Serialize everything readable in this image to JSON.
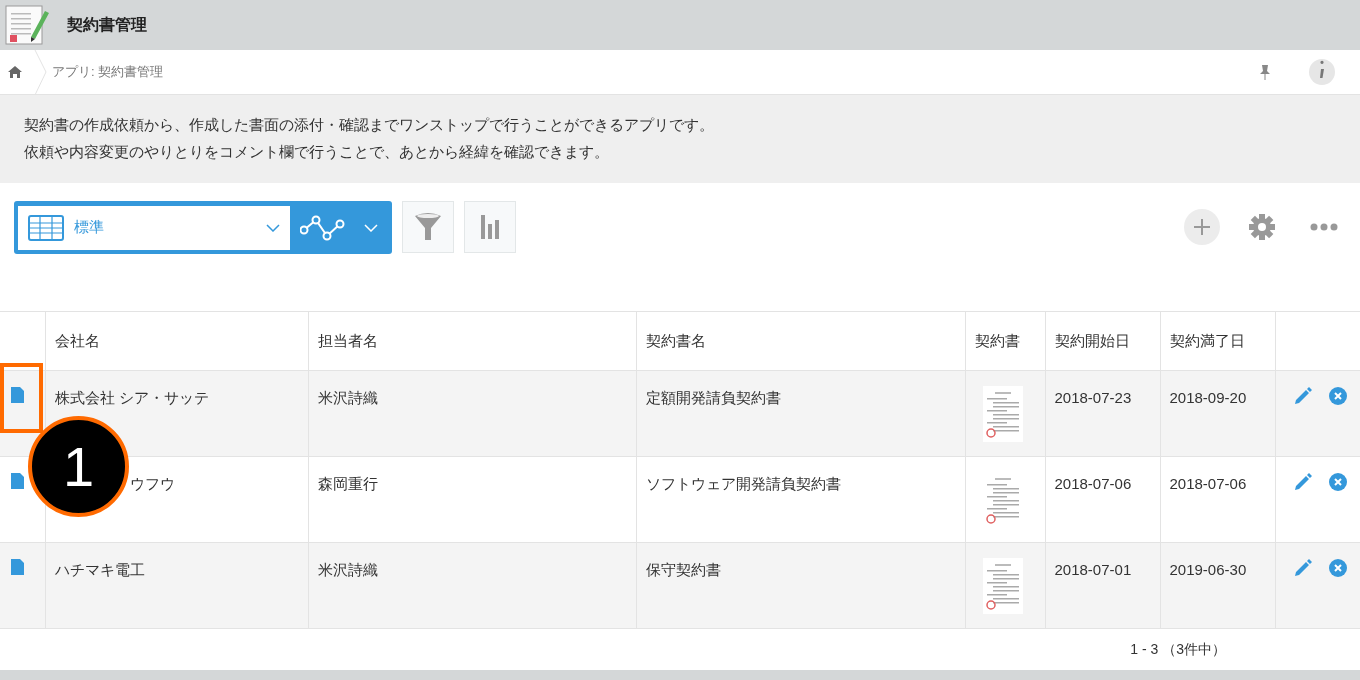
{
  "app": {
    "title": "契約書管理"
  },
  "breadcrumb": {
    "path": "アプリ: 契約書管理"
  },
  "description": [
    "契約書の作成依頼から、作成した書面の添付・確認までワンストップで行うことができるアプリです。",
    "依頼や内容変更のやりとりをコメント欄で行うことで、あとから経緯を確認できます。"
  ],
  "view_selector": {
    "value": "標準"
  },
  "table": {
    "columns": [
      "会社名",
      "担当者名",
      "契約書名",
      "契約書",
      "契約開始日",
      "契約満了日"
    ],
    "rows": [
      {
        "company": "株式会社 シア・サッテ",
        "person": "米沢詩織",
        "contract": "定額開発請負契約書",
        "start": "2018-07-23",
        "end": "2018-09-20",
        "covered": false,
        "highlighted": true
      },
      {
        "company": "ウフウ",
        "person": "森岡重行",
        "contract": "ソフトウェア開発請負契約書",
        "start": "2018-07-06",
        "end": "2018-07-06",
        "covered": true,
        "highlighted": false
      },
      {
        "company": "ハチマキ電工",
        "person": "米沢詩織",
        "contract": "保守契約書",
        "start": "2018-07-01",
        "end": "2019-06-30",
        "covered": false,
        "highlighted": false
      }
    ]
  },
  "pagination": "1 - 3 （3件中）",
  "callout": {
    "number": "1"
  }
}
